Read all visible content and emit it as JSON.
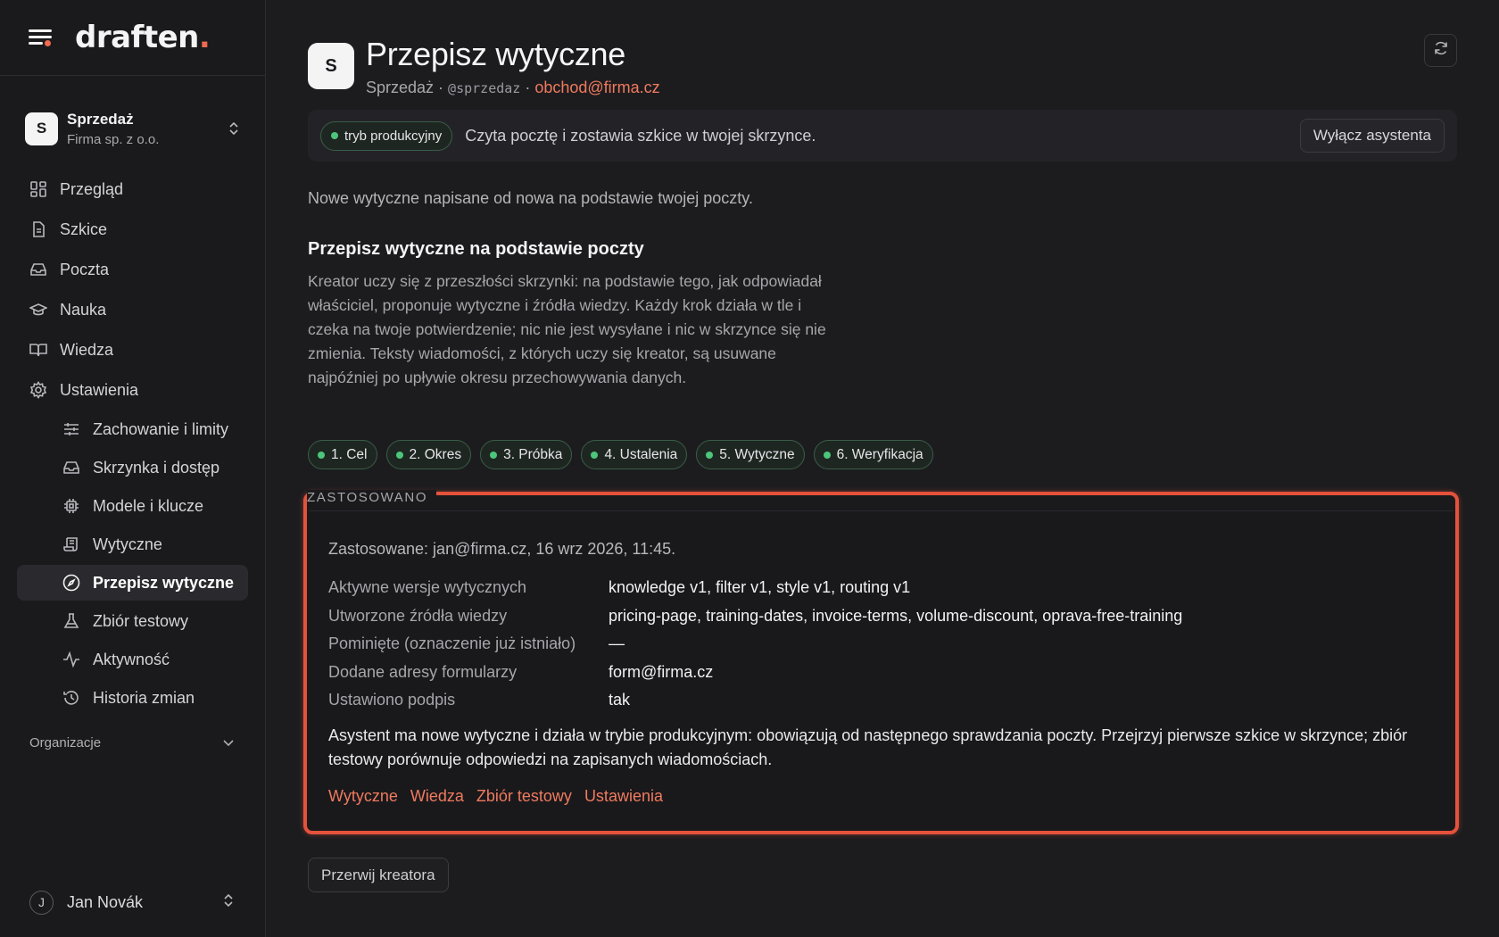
{
  "brand": {
    "name": "draften",
    "dot": "."
  },
  "workspace": {
    "initial": "S",
    "name": "Sprzedaż",
    "org": "Firma sp. z o.o."
  },
  "nav": {
    "items": [
      {
        "label": "Przegląd",
        "icon": "grid-icon"
      },
      {
        "label": "Szkice",
        "icon": "document-icon"
      },
      {
        "label": "Poczta",
        "icon": "inbox-icon"
      },
      {
        "label": "Nauka",
        "icon": "graduation-cap-icon"
      },
      {
        "label": "Wiedza",
        "icon": "book-icon"
      },
      {
        "label": "Ustawienia",
        "icon": "gear-icon"
      }
    ],
    "subitems": [
      {
        "label": "Zachowanie i limity",
        "icon": "sliders-icon"
      },
      {
        "label": "Skrzynka i dostęp",
        "icon": "inbox-icon"
      },
      {
        "label": "Modele i klucze",
        "icon": "chip-icon"
      },
      {
        "label": "Wytyczne",
        "icon": "scroll-icon"
      },
      {
        "label": "Przepisz wytyczne",
        "icon": "compass-icon",
        "active": true
      },
      {
        "label": "Zbiór testowy",
        "icon": "flask-icon"
      },
      {
        "label": "Aktywność",
        "icon": "activity-icon"
      },
      {
        "label": "Historia zmian",
        "icon": "history-icon"
      }
    ],
    "org_label": "Organizacje"
  },
  "user": {
    "initial": "J",
    "name": "Jan Novák"
  },
  "header": {
    "initial": "S",
    "title": "Przepisz wytyczne",
    "team": "Sprzedaż",
    "sep": " · ",
    "handle": "@sprzedaz",
    "email": "obchod@firma.cz"
  },
  "status": {
    "badge": "tryb produkcyjny",
    "text": "Czyta pocztę i zostawia szkice w twojej skrzynce.",
    "button": "Wyłącz asystenta"
  },
  "intro": "Nowe wytyczne napisane od nowa na podstawie twojej poczty.",
  "section": {
    "title": "Przepisz wytyczne na podstawie poczty",
    "desc": "Kreator uczy się z przeszłości skrzynki: na podstawie tego, jak odpowiadał właściciel, proponuje wytyczne i źródła wiedzy. Każdy krok działa w tle i czeka na twoje potwierdzenie; nic nie jest wysyłane i nic w skrzynce się nie zmienia. Teksty wiadomości, z których uczy się kreator, są usuwane najpóźniej po upływie okresu przechowywania danych."
  },
  "steps": [
    "1. Cel",
    "2. Okres",
    "3. Próbka",
    "4. Ustalenia",
    "5. Wytyczne",
    "6. Weryfikacja"
  ],
  "applied": {
    "label": "ZASTOSOWANO",
    "meta": "Zastosowane: jan@firma.cz, 16 wrz 2026, 11:45.",
    "rows": [
      {
        "key": "Aktywne wersje wytycznych",
        "value": "knowledge v1, filter v1, style v1, routing v1"
      },
      {
        "key": "Utworzone źródła wiedzy",
        "value": "pricing-page, training-dates, invoice-terms, volume-discount, oprava-free-training"
      },
      {
        "key": "Pominięte (oznaczenie już istniało)",
        "value": "—"
      },
      {
        "key": "Dodane adresy formularzy",
        "value": "form@firma.cz"
      },
      {
        "key": "Ustawiono podpis",
        "value": "tak"
      }
    ],
    "note": "Asystent ma nowe wytyczne i działa w trybie produkcyjnym: obowiązują od następnego sprawdzania poczty. Przejrzyj pierwsze szkice w skrzynce; zbiór testowy porównuje odpowiedzi na zapisanych wiadomościach.",
    "links": [
      "Wytyczne",
      "Wiedza",
      "Zbiór testowy",
      "Ustawienia"
    ]
  },
  "abort_button": "Przerwij kreatora",
  "colors": {
    "accent": "#f07a5e",
    "highlight": "#e5523c",
    "success": "#4cc67a",
    "background": "#1c1c1f"
  }
}
